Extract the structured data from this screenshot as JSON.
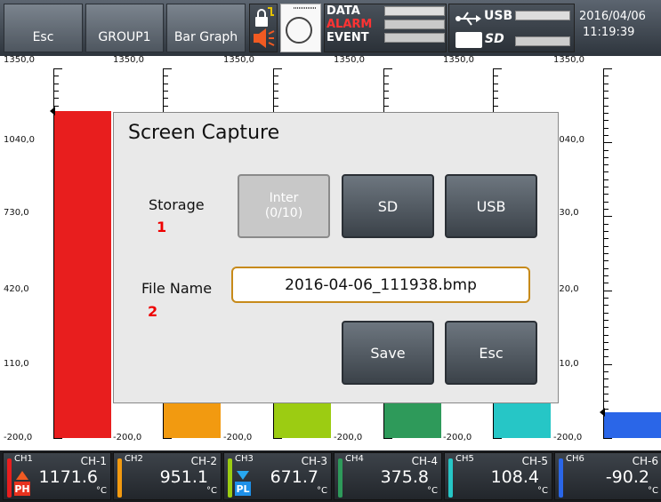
{
  "header": {
    "esc_label": "Esc",
    "group_label": "GROUP1",
    "view_label": "Bar Graph",
    "data_label": "DATA",
    "alarm_label": "ALARM",
    "event_label": "EVENT",
    "usb_label": "USB",
    "sd_label": "SD",
    "date": "2016/04/06",
    "time": "11:19:39"
  },
  "scale": {
    "labels": [
      "1350,0",
      "1040,0",
      "730,0",
      "420,0",
      "110,0",
      "-200,0"
    ]
  },
  "bar_levels": [
    {
      "channel": "CH-1",
      "value": 1171.6,
      "color": "#e81e1e"
    },
    {
      "channel": "CH-2",
      "value": 951.1,
      "color": "#f29a10"
    },
    {
      "channel": "CH-3",
      "value": 671.7,
      "color": "#9ccc12"
    },
    {
      "channel": "CH-4",
      "value": 375.8,
      "color": "#2e9a5a"
    },
    {
      "channel": "CH-5",
      "value": 108.4,
      "color": "#26c6c6"
    },
    {
      "channel": "CH-6",
      "value": -90.2,
      "color": "#2a66e8"
    }
  ],
  "dialog": {
    "title": "Screen Capture",
    "storage_label": "Storage",
    "storage_num": "1",
    "file_name_label": "File Name",
    "file_name_num": "2",
    "btn_inter_line1": "Inter",
    "btn_inter_line2": "(0/10)",
    "btn_sd": "SD",
    "btn_usb": "USB",
    "file_name_value": "2016-04-06_111938.bmp",
    "btn_save": "Save",
    "btn_esc": "Esc"
  },
  "channels": [
    {
      "tag": "CH1",
      "name": "CH-1",
      "value": "1171.6",
      "unit": "°C",
      "badge": "PH",
      "color": "#e81e1e"
    },
    {
      "tag": "CH2",
      "name": "CH-2",
      "value": "951.1",
      "unit": "°C",
      "badge": "",
      "color": "#f29a10"
    },
    {
      "tag": "CH3",
      "name": "CH-3",
      "value": "671.7",
      "unit": "°C",
      "badge": "PL",
      "color": "#9ccc12"
    },
    {
      "tag": "CH4",
      "name": "CH-4",
      "value": "375.8",
      "unit": "°C",
      "badge": "",
      "color": "#2e9a5a"
    },
    {
      "tag": "CH5",
      "name": "CH-5",
      "value": "108.4",
      "unit": "°C",
      "badge": "",
      "color": "#26c6c6"
    },
    {
      "tag": "CH6",
      "name": "CH-6",
      "value": "-90.2",
      "unit": "°C",
      "badge": "",
      "color": "#2a66e8"
    }
  ]
}
